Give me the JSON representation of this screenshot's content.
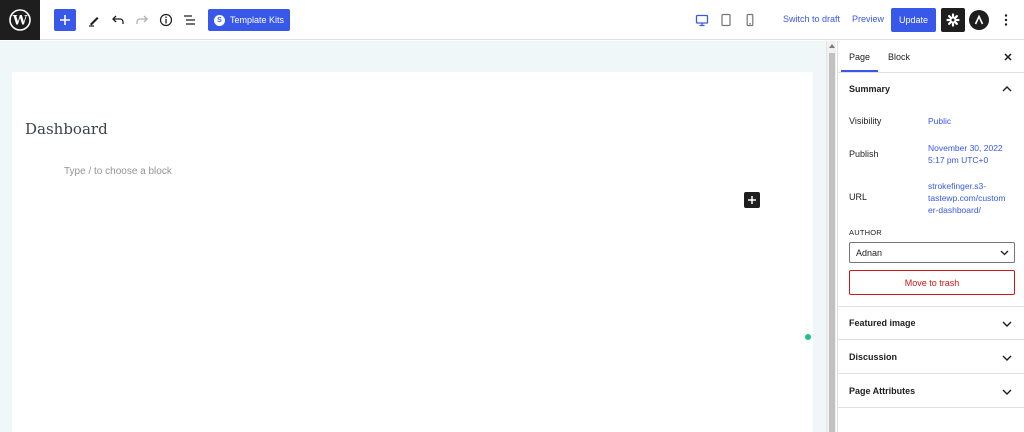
{
  "toolbar": {
    "template_kits_label": "Template Kits",
    "template_kits_icon": "S",
    "switch_to_draft": "Switch to draft",
    "preview": "Preview",
    "update": "Update",
    "icons": [
      "wordpress-logo-icon",
      "plus-icon",
      "pen-icon",
      "undo-icon",
      "redo-icon",
      "info-icon",
      "list-view-icon",
      "desktop-icon",
      "tablet-icon",
      "mobile-icon",
      "gear-icon",
      "astra-icon",
      "more-vertical-icon"
    ]
  },
  "editor": {
    "title": "Dashboard",
    "block_placeholder": "Type / to choose a block"
  },
  "sidebar": {
    "tabs": [
      "Page",
      "Block"
    ],
    "active_tab": "Page",
    "summary": {
      "heading": "Summary",
      "visibility_label": "Visibility",
      "visibility_value": "Public",
      "publish_label": "Publish",
      "publish_line1": "November 30, 2022",
      "publish_line2": "5:17 pm UTC+0",
      "url_label": "URL",
      "url_line1": "strokefinger.s3-",
      "url_line2": "tastewp.com/custom",
      "url_line3": "er-dashboard/",
      "author_label": "AUTHOR",
      "author_value": "Adnan",
      "trash_label": "Move to trash"
    },
    "panels": [
      "Featured image",
      "Discussion",
      "Page Attributes"
    ]
  },
  "colors": {
    "accent": "#3858e9",
    "dark": "#1e1e1e",
    "danger": "#cc1818",
    "canvas_bg": "#f0f7f9",
    "status_dot": "#1ec288"
  }
}
